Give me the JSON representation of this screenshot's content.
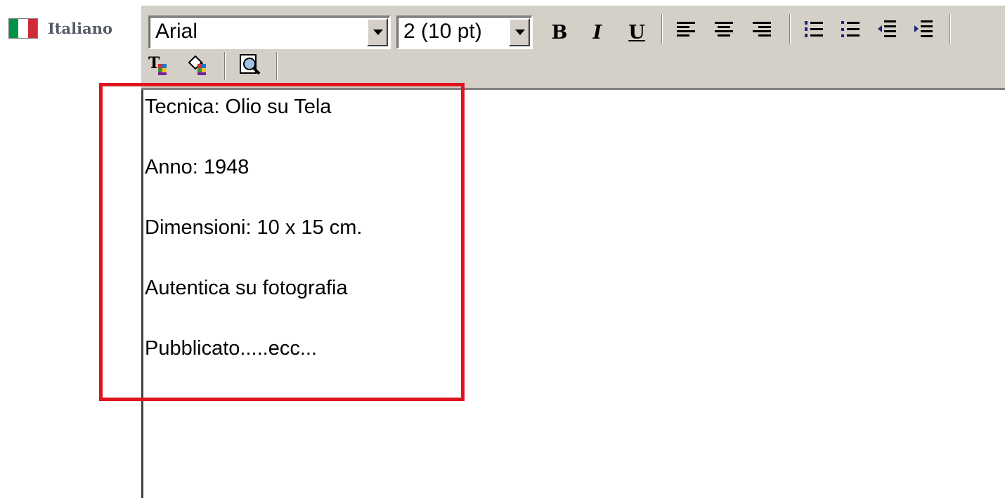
{
  "language": {
    "label": "Italiano",
    "flag_colors": [
      "#009246",
      "#ffffff",
      "#ce2b37"
    ]
  },
  "toolbar": {
    "font_select": {
      "value": "Arial"
    },
    "size_select": {
      "value": "2 (10 pt)"
    },
    "bold_label": "B",
    "italic_label": "I",
    "underline_label": "U",
    "icons": [
      "align-left-icon",
      "align-center-icon",
      "align-right-icon",
      "numbered-list-icon",
      "bulleted-list-icon",
      "outdent-icon",
      "indent-icon",
      "text-color-icon",
      "highlight-color-icon",
      "preview-icon"
    ]
  },
  "editor": {
    "lines": [
      "Tecnica: Olio su Tela",
      "Anno: 1948",
      "Dimensioni: 10 x 15 cm.",
      "Autentica su fotografia",
      "Pubblicato.....ecc..."
    ]
  },
  "colors": {
    "toolbar_bg": "#d4d0c8",
    "highlight_border": "#e0141e",
    "icon_blue": "#1a237e"
  }
}
